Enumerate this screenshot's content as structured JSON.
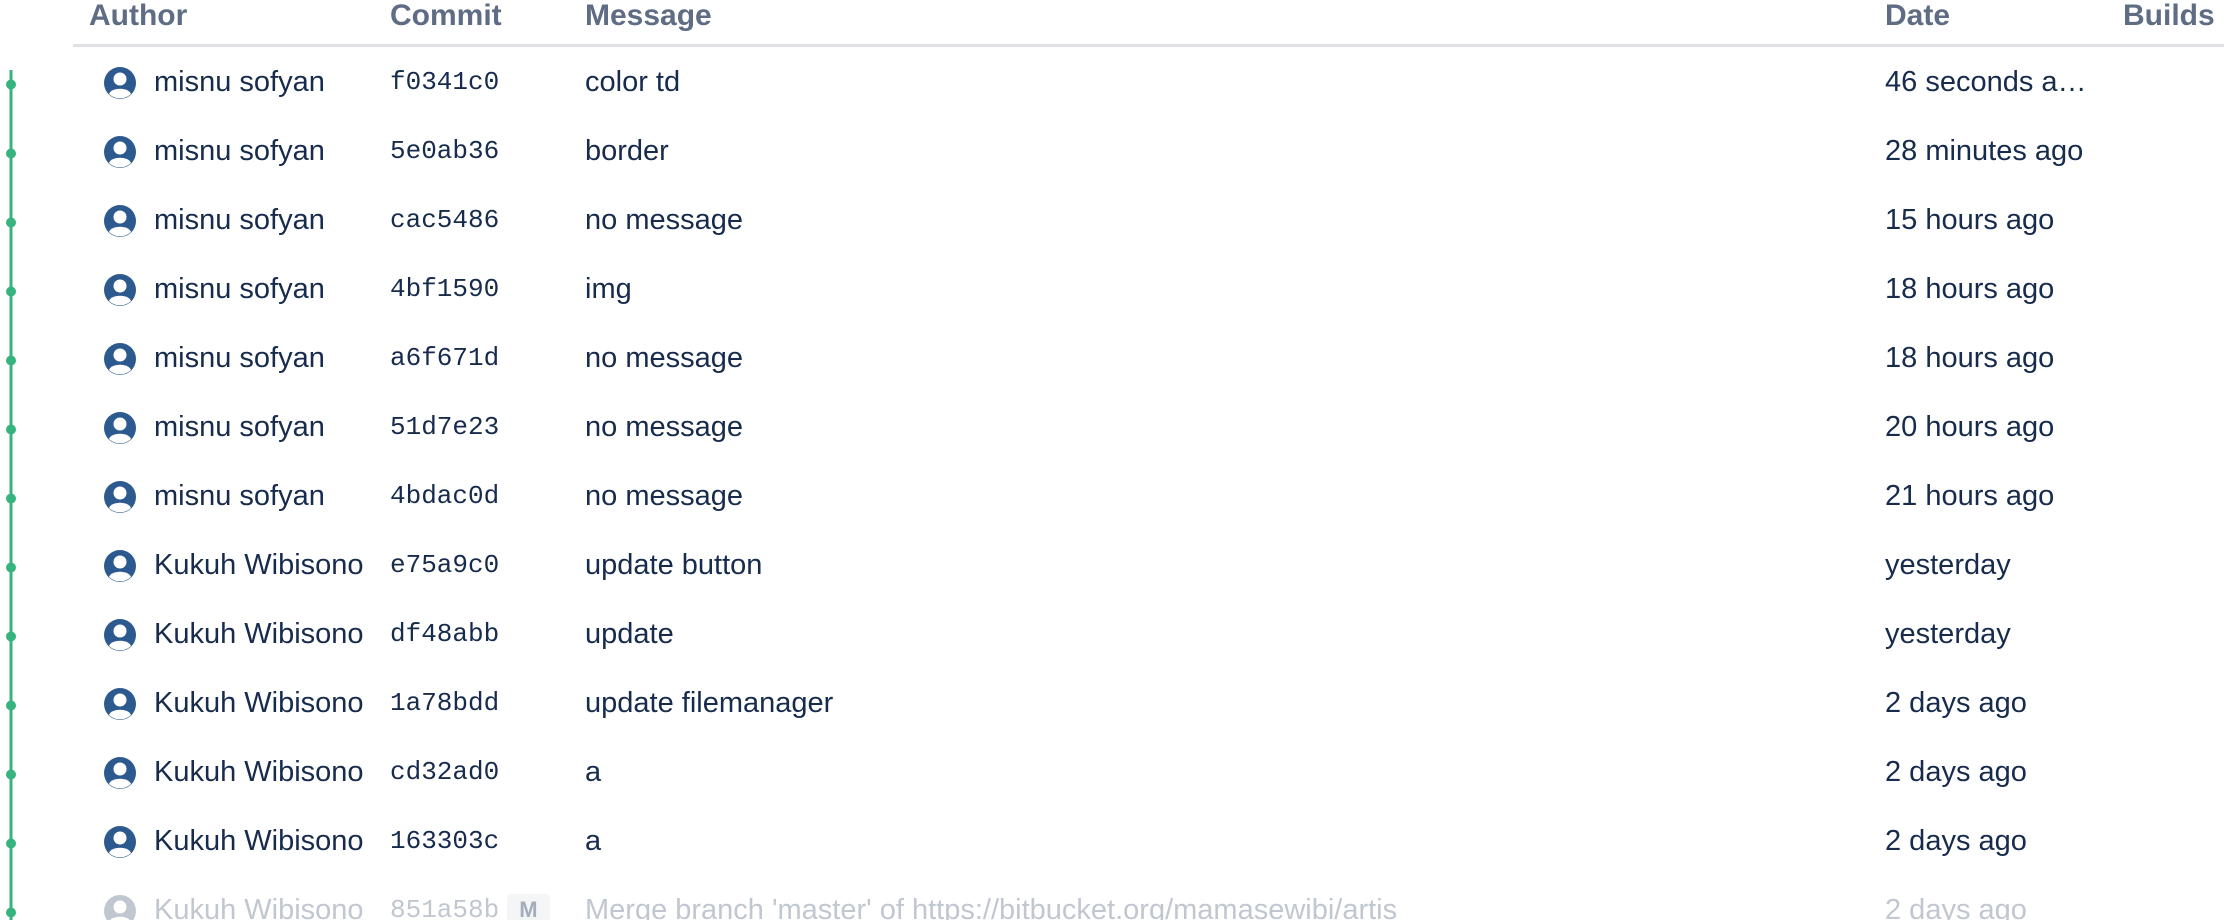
{
  "colors": {
    "graph_line": "#36b37e",
    "avatar": "#2d5a8e",
    "avatar_faded": "#c1c7d0",
    "header_text": "#5e6c84",
    "header_border": "#dfe1e6"
  },
  "table": {
    "headers": {
      "author": "Author",
      "commit": "Commit",
      "message": "Message",
      "date": "Date",
      "builds": "Builds"
    },
    "rows": [
      {
        "author": "misnu sofyan",
        "commit": "f0341c0",
        "message": "color td",
        "date": "46 seconds a…",
        "faded": false
      },
      {
        "author": "misnu sofyan",
        "commit": "5e0ab36",
        "message": "border",
        "date": "28 minutes ago",
        "faded": false
      },
      {
        "author": "misnu sofyan",
        "commit": "cac5486",
        "message": "no message",
        "date": "15 hours ago",
        "faded": false
      },
      {
        "author": "misnu sofyan",
        "commit": "4bf1590",
        "message": "img",
        "date": "18 hours ago",
        "faded": false
      },
      {
        "author": "misnu sofyan",
        "commit": "a6f671d",
        "message": "no message",
        "date": "18 hours ago",
        "faded": false
      },
      {
        "author": "misnu sofyan",
        "commit": "51d7e23",
        "message": "no message",
        "date": "20 hours ago",
        "faded": false
      },
      {
        "author": "misnu sofyan",
        "commit": "4bdac0d",
        "message": "no message",
        "date": "21 hours ago",
        "faded": false
      },
      {
        "author": "Kukuh Wibisono",
        "commit": "e75a9c0",
        "message": "update button",
        "date": "yesterday",
        "faded": false
      },
      {
        "author": "Kukuh Wibisono",
        "commit": "df48abb",
        "message": "update",
        "date": "yesterday",
        "faded": false
      },
      {
        "author": "Kukuh Wibisono",
        "commit": "1a78bdd",
        "message": "update filemanager",
        "date": "2 days ago",
        "faded": false
      },
      {
        "author": "Kukuh Wibisono",
        "commit": "cd32ad0",
        "message": "a",
        "date": "2 days ago",
        "faded": false
      },
      {
        "author": "Kukuh Wibisono",
        "commit": "163303c",
        "message": "a",
        "date": "2 days ago",
        "faded": false
      },
      {
        "author": "Kukuh Wibisono",
        "commit": "851a58b",
        "message": "Merge branch 'master' of https://bitbucket.org/mamasewibi/artis",
        "date": "2 days ago",
        "faded": true,
        "badge": "M"
      }
    ]
  }
}
